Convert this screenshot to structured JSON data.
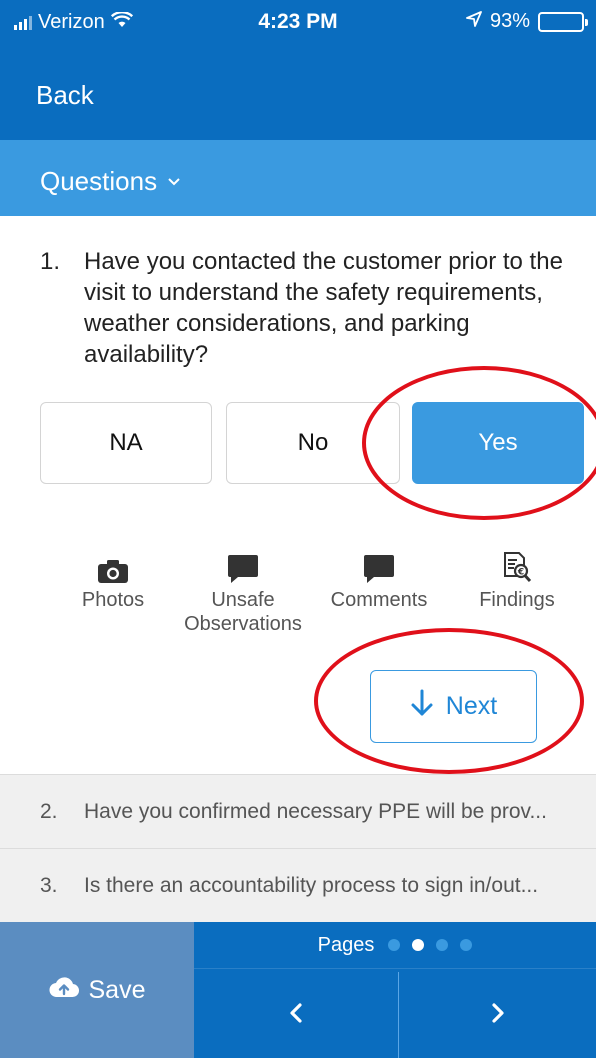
{
  "status_bar": {
    "carrier": "Verizon",
    "time": "4:23 PM",
    "battery": "93%"
  },
  "nav": {
    "back_label": "Back"
  },
  "section": {
    "title": "Questions"
  },
  "question": {
    "number": "1.",
    "text": "Have you contacted the customer prior to the visit to understand the safety requirements, weather considerations, and parking availability?"
  },
  "answers": {
    "na": "NA",
    "no": "No",
    "yes": "Yes",
    "selected": "Yes"
  },
  "tools": {
    "photos": "Photos",
    "unsafe_line1": "Unsafe",
    "unsafe_line2": "Observations",
    "comments": "Comments",
    "findings": "Findings"
  },
  "next_label": "Next",
  "other_questions": [
    {
      "number": "2.",
      "text": "Have you confirmed necessary PPE will be prov..."
    },
    {
      "number": "3.",
      "text": "Is there an accountability process to sign in/out..."
    }
  ],
  "footer": {
    "save_label": "Save",
    "pages_label": "Pages",
    "page_count": 4,
    "current_page": 2
  },
  "colors": {
    "primary": "#0a6dbf",
    "accent": "#3a9ae0",
    "save": "#5b8dc1",
    "annotation": "#e0101a"
  }
}
